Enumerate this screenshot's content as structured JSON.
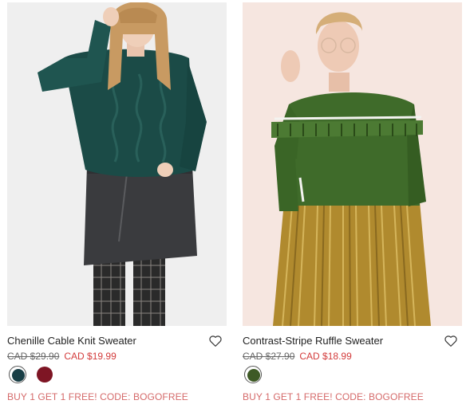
{
  "products": [
    {
      "name": "Chenille Cable Knit Sweater",
      "original_price": "CAD $29.90",
      "sale_price": "CAD $19.99",
      "promo": "BUY 1 GET 1 FREE! CODE: BOGOFREE",
      "swatches": [
        {
          "color": "#183e45",
          "selected": true
        },
        {
          "color": "#7e1524",
          "selected": false
        }
      ]
    },
    {
      "name": "Contrast-Stripe Ruffle Sweater",
      "original_price": "CAD $27.90",
      "sale_price": "CAD $18.99",
      "promo": "BUY 1 GET 1 FREE! CODE: BOGOFREE",
      "swatches": [
        {
          "color": "#3e5a25",
          "selected": true
        }
      ]
    }
  ],
  "colors": {
    "sale_price": "#d33c3c",
    "promo": "#d56a6a",
    "sweater_teal": "#1b4b47",
    "sweater_green": "#3f6b2a",
    "skirt_gold": "#b08a2e"
  },
  "icons": {
    "wishlist": "heart-outline-icon"
  }
}
